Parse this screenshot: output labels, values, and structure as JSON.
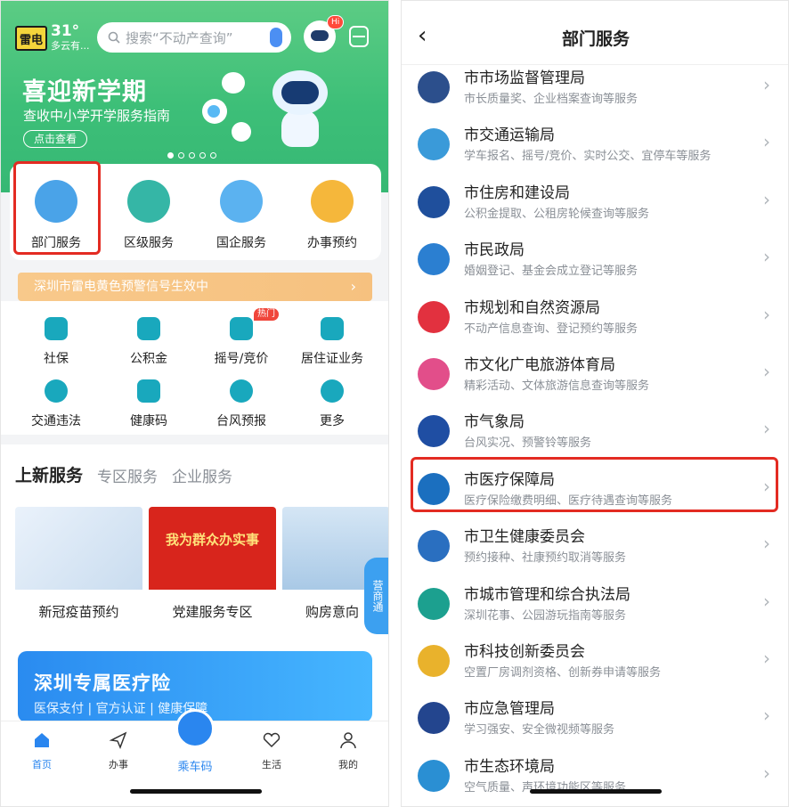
{
  "left": {
    "weather": {
      "icon_text": "雷电",
      "temp": "31°",
      "desc": "多云有..."
    },
    "search": {
      "placeholder": "搜索“不动产查询”"
    },
    "hi_badge": "Hi",
    "hero": {
      "title": "喜迎新学期",
      "subtitle": "查收中小学开学服务指南",
      "button": "点击查看"
    },
    "services": [
      {
        "label": "部门服务",
        "color": "#4aa3e8"
      },
      {
        "label": "区级服务",
        "color": "#35b6a6"
      },
      {
        "label": "国企服务",
        "color": "#5bb2f0"
      },
      {
        "label": "办事预约",
        "color": "#f5b73b"
      }
    ],
    "alert": {
      "text": "深圳市雷电黄色预警信号生效中",
      "arrow": "›"
    },
    "tools_row1": [
      {
        "label": "社保"
      },
      {
        "label": "公积金"
      },
      {
        "label": "摇号/竞价"
      },
      {
        "label": "居住证业务"
      }
    ],
    "tools_row2": [
      {
        "label": "交通违法"
      },
      {
        "label": "健康码"
      },
      {
        "label": "台风预报"
      },
      {
        "label": "更多"
      }
    ],
    "hot_badge": "热门",
    "news_tabs": [
      "上新服务",
      "专区服务",
      "企业服务"
    ],
    "tiles": [
      {
        "label": "新冠疫苗预约",
        "img_text": "",
        "color": "#dfe9f4"
      },
      {
        "label": "党建服务专区",
        "img_text": "我为群众办实事",
        "color": "#d8251c"
      },
      {
        "label": "购房意向",
        "img_text": "",
        "color": "#c8dff1"
      }
    ],
    "side_tab": "营商通",
    "banner": {
      "title": "深圳专属医疗险",
      "subtitle": "医保支付 | 官方认证 | 健康保障"
    },
    "nav": {
      "home": "首页",
      "work": "办事",
      "bus": "乘车码",
      "life": "生活",
      "mine": "我的"
    }
  },
  "right": {
    "back": "‹",
    "title": "部门服务",
    "items": [
      {
        "title": "市市场监督管理局",
        "sub": "市长质量奖、企业档案查询等服务",
        "color": "#2c4f8c"
      },
      {
        "title": "市交通运输局",
        "sub": "学车报名、摇号/竞价、实时公交、宜停车等服务",
        "color": "#3a9ad9"
      },
      {
        "title": "市住房和建设局",
        "sub": "公积金提取、公租房轮候查询等服务",
        "color": "#1f4f9c"
      },
      {
        "title": "市民政局",
        "sub": "婚姻登记、基金会成立登记等服务",
        "color": "#2b7fd1"
      },
      {
        "title": "市规划和自然资源局",
        "sub": "不动产信息查询、登记预约等服务",
        "color": "#e2313f"
      },
      {
        "title": "市文化广电旅游体育局",
        "sub": "精彩活动、文体旅游信息查询等服务",
        "color": "#e24e8a"
      },
      {
        "title": "市气象局",
        "sub": "台风实况、预警铃等服务",
        "color": "#1f4ea3"
      },
      {
        "title": "市医疗保障局",
        "sub": "医疗保险缴费明细、医疗待遇查询等服务",
        "color": "#1b6fbf"
      },
      {
        "title": "市卫生健康委员会",
        "sub": "预约接种、社康预约取消等服务",
        "color": "#2a6fc0"
      },
      {
        "title": "市城市管理和综合执法局",
        "sub": "深圳花事、公园游玩指南等服务",
        "color": "#1ca08f"
      },
      {
        "title": "市科技创新委员会",
        "sub": "空置厂房调剂资格、创新券申请等服务",
        "color": "#e9b22c"
      },
      {
        "title": "市应急管理局",
        "sub": "学习强安、安全微视频等服务",
        "color": "#23458e"
      },
      {
        "title": "市生态环境局",
        "sub": "空气质量、声环境功能区等服务",
        "color": "#2a8fd3"
      }
    ],
    "arrow": "›"
  }
}
